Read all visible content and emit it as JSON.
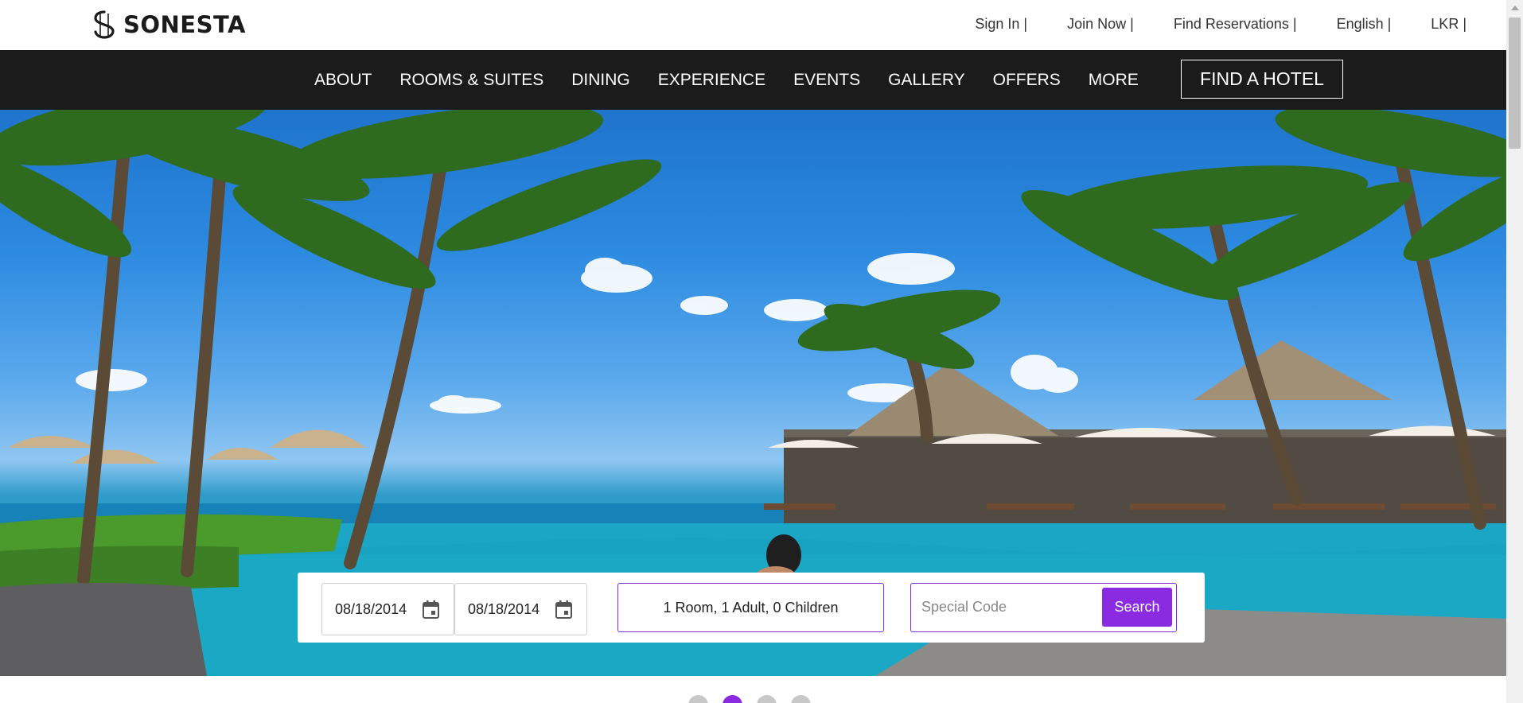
{
  "brand": {
    "name": "SONESTA",
    "icon": "sonesta-logo-mark"
  },
  "utility_links": [
    {
      "label": "Sign In |"
    },
    {
      "label": "Join Now |"
    },
    {
      "label": "Find Reservations |"
    },
    {
      "label": "English |"
    },
    {
      "label": "LKR |"
    }
  ],
  "nav": {
    "items": [
      {
        "label": "ABOUT"
      },
      {
        "label": "ROOMS & SUITES"
      },
      {
        "label": "DINING"
      },
      {
        "label": "EXPERIENCE"
      },
      {
        "label": "EVENTS"
      },
      {
        "label": "GALLERY"
      },
      {
        "label": "OFFERS"
      },
      {
        "label": "MORE"
      }
    ],
    "cta_label": "FIND A HOTEL"
  },
  "hero": {
    "scene": "tropical resort pool with palm trees and thatched huts"
  },
  "booking": {
    "check_in": "08/18/2014",
    "check_out": "08/18/2014",
    "calendar_icon": "calendar-icon",
    "guests": "1 Room, 1 Adult, 0 Children",
    "promo_placeholder": "Special Code",
    "search_label": "Search"
  },
  "carousel": {
    "slide_count": 4,
    "active_index": 1
  },
  "colors": {
    "accent": "#8a2be2",
    "nav_bg": "#1b1b1b",
    "text": "#222222"
  }
}
